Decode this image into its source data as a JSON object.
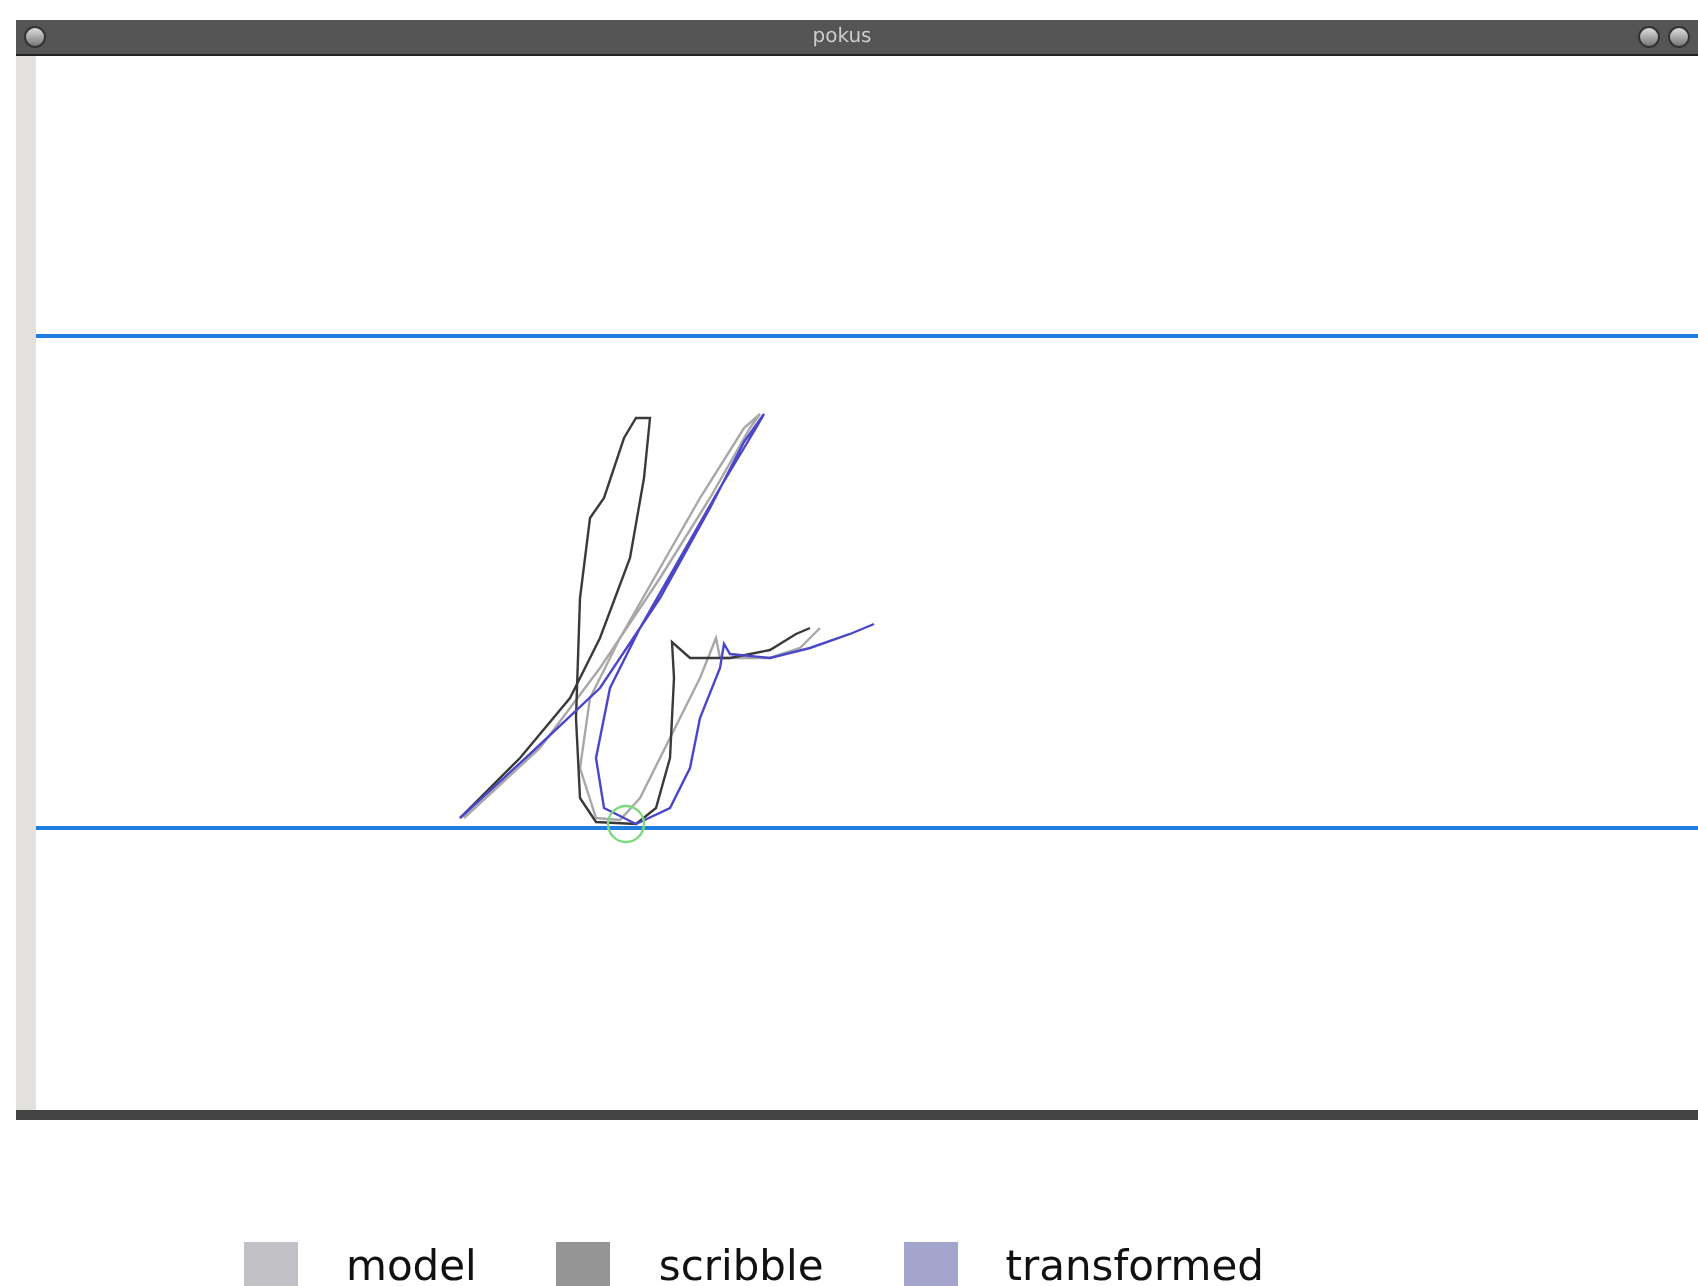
{
  "window": {
    "title": "pokus"
  },
  "legend": [
    {
      "label": "model",
      "color": "#c2c1c6"
    },
    {
      "label": "scribble",
      "color": "#959595"
    },
    {
      "label": "transformed",
      "color": "#a3a5cd"
    }
  ]
}
